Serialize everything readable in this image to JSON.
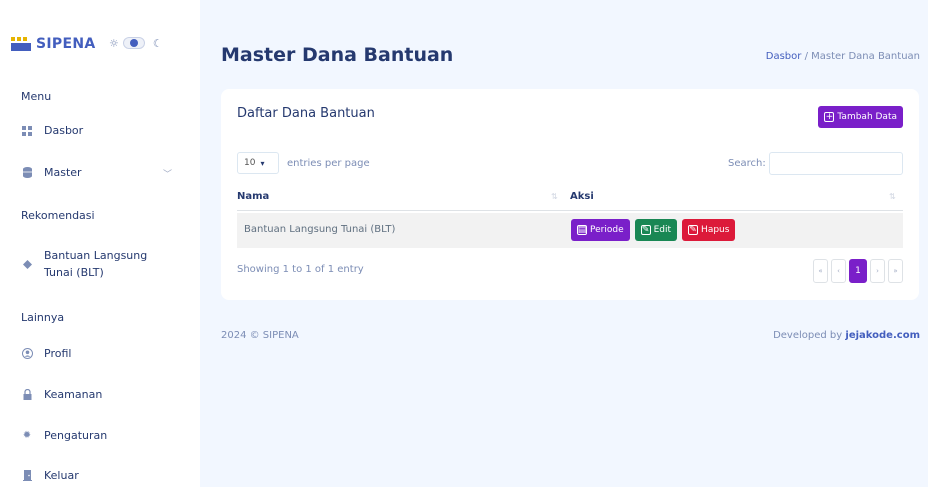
{
  "app": {
    "brand": "SIPENA"
  },
  "sidebar": {
    "menu_title": "Menu",
    "dasbor": "Dasbor",
    "master": "Master",
    "rekomendasi_title": "Rekomendasi",
    "blt_line1": "Bantuan Langsung",
    "blt_line2": "Tunai (BLT)",
    "lainnya_title": "Lainnya",
    "profil": "Profil",
    "keamanan": "Keamanan",
    "pengaturan": "Pengaturan",
    "keluar": "Keluar"
  },
  "header": {
    "title": "Master Dana Bantuan",
    "breadcrumb_link": "Dasbor",
    "breadcrumb_sep": "/",
    "breadcrumb_current": "Master Dana Bantuan"
  },
  "card": {
    "title": "Daftar Dana Bantuan",
    "add_button": "Tambah Data",
    "entries_value": "10",
    "entries_label": "entries per page",
    "search_label": "Search:",
    "search_value": "",
    "columns": [
      "Nama",
      "Aksi"
    ],
    "rows": [
      {
        "nama": "Bantuan Langsung Tunai (BLT)"
      }
    ],
    "actions": {
      "periode": "Periode",
      "edit": "Edit",
      "hapus": "Hapus"
    },
    "showing": "Showing 1 to 1 of 1 entry",
    "pagination": {
      "first": "«",
      "prev": "‹",
      "current": "1",
      "next": "›",
      "last": "»"
    }
  },
  "footer": {
    "copyright": "2024 © SIPENA",
    "developed_by": "Developed by",
    "developer": "jejakode.com"
  },
  "colors": {
    "primary": "#435ebe",
    "purple": "#7a1fc9",
    "green": "#198754",
    "red": "#dc1a3a",
    "background": "#f2f7ff"
  },
  "icons": {
    "dasbor": "grid-icon",
    "master": "database-icon",
    "blt": "diamond-icon",
    "profil": "person-circle-icon",
    "keamanan": "lock-icon",
    "pengaturan": "gear-icon",
    "keluar": "door-icon"
  }
}
